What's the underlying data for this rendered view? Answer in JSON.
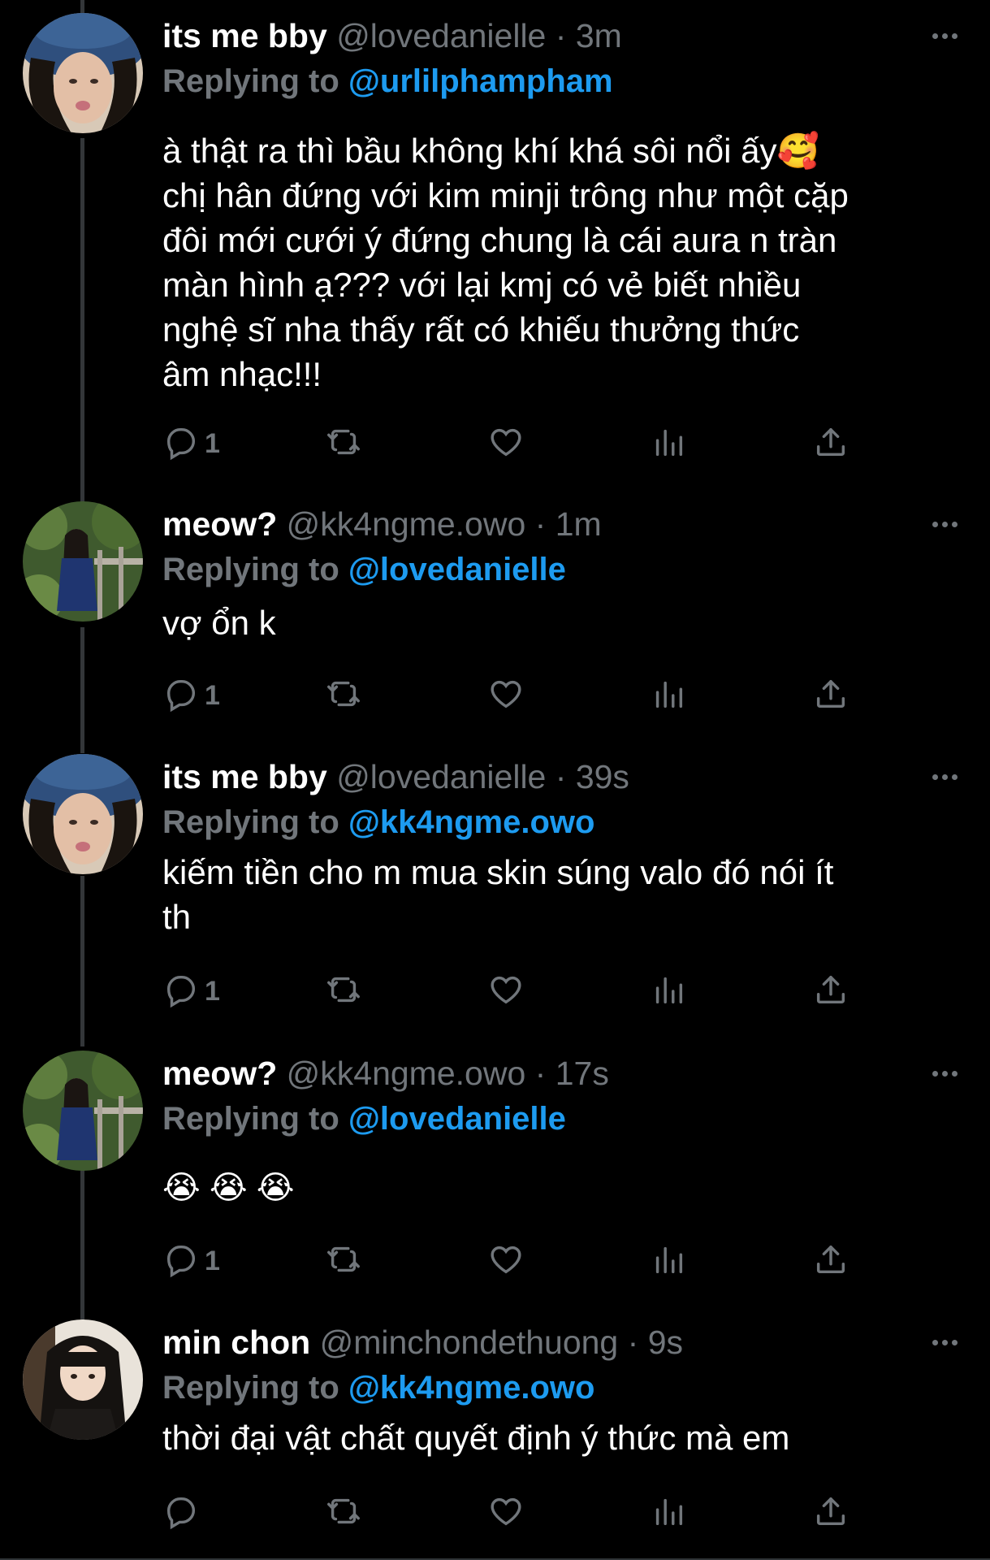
{
  "tweets": [
    {
      "name": "its me bby",
      "handle": "@lovedanielle",
      "dot": "·",
      "time": "3m",
      "replying_label": "Replying to",
      "replying_to": "@urlilphampham",
      "text": "à thật ra thì bầu không khí khá sôi nổi ấy🥰\nchị hân đứng với kim minji trông như một cặp\nđôi mới cưới ý đứng chung là cái aura n tràn\nmàn hình ạ??? với lại kmj có vẻ biết nhiều\nnghệ sĩ nha thấy rất có khiếu thưởng thức\nâm nhạc!!!",
      "reply_count": "1",
      "avatar": "avatar-blue-hat"
    },
    {
      "name": "meow?",
      "handle": "@kk4ngme.owo",
      "dot": "·",
      "time": "1m",
      "replying_label": "Replying to",
      "replying_to": "@lovedanielle",
      "text": "vợ ổn k",
      "reply_count": "1",
      "avatar": "avatar-garden"
    },
    {
      "name": "its me bby",
      "handle": "@lovedanielle",
      "dot": "·",
      "time": "39s",
      "replying_label": "Replying to",
      "replying_to": "@kk4ngme.owo",
      "text": "kiếm tiền cho m mua skin súng valo đó nói ít\nth",
      "reply_count": "1",
      "avatar": "avatar-blue-hat"
    },
    {
      "name": "meow?",
      "handle": "@kk4ngme.owo",
      "dot": "·",
      "time": "17s",
      "replying_label": "Replying to",
      "replying_to": "@lovedanielle",
      "text": "😭 😭 😭",
      "reply_count": "1",
      "avatar": "avatar-garden"
    },
    {
      "name": "min chon",
      "handle": "@minchondethuong",
      "dot": "·",
      "time": "9s",
      "replying_label": "Replying to",
      "replying_to": "@kk4ngme.owo",
      "text": "thời đại vật chất quyết định ý thức mà em",
      "reply_count": "",
      "avatar": "avatar-dark-hair"
    }
  ],
  "icons": {
    "reply": "reply-icon",
    "retweet": "retweet-icon",
    "like": "heart-icon",
    "views": "analytics-icon",
    "share": "share-icon",
    "more": "more-icon"
  },
  "colors": {
    "background": "#000000",
    "name": "#ffffff",
    "secondary": "#71767b",
    "mention": "#1d9bf0",
    "thread_line": "#333639"
  }
}
